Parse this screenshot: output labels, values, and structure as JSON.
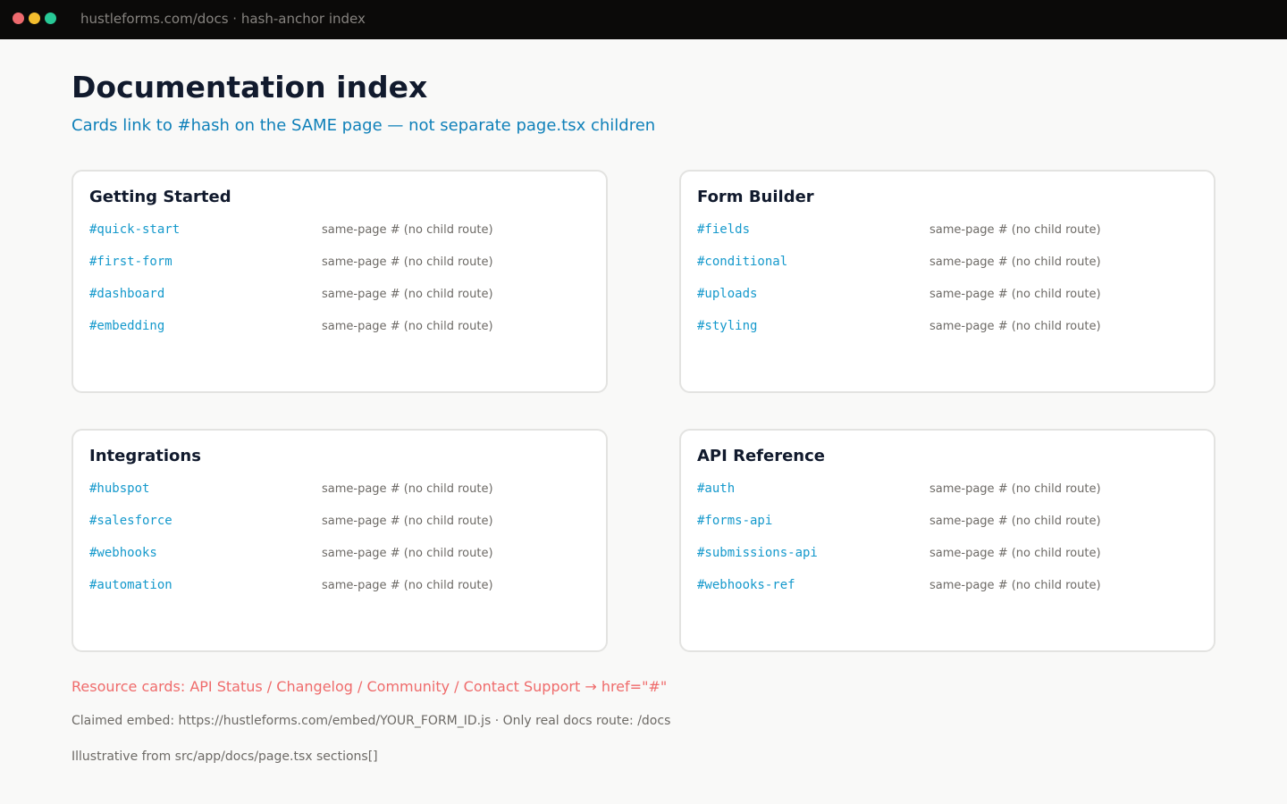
{
  "window": {
    "url": "hustleforms.com/docs · hash-anchor index",
    "controls": [
      "close",
      "minimize",
      "maximize"
    ]
  },
  "page": {
    "title": "Documentation index",
    "subtitle": "Cards link to #hash on the SAME page — not separate page.tsx children"
  },
  "sections": [
    {
      "title": "Getting Started",
      "items": [
        {
          "anchor": "#quick-start",
          "note": "same-page # (no child route)"
        },
        {
          "anchor": "#first-form",
          "note": "same-page # (no child route)"
        },
        {
          "anchor": "#dashboard",
          "note": "same-page # (no child route)"
        },
        {
          "anchor": "#embedding",
          "note": "same-page # (no child route)"
        }
      ]
    },
    {
      "title": "Form Builder",
      "items": [
        {
          "anchor": "#fields",
          "note": "same-page # (no child route)"
        },
        {
          "anchor": "#conditional",
          "note": "same-page # (no child route)"
        },
        {
          "anchor": "#uploads",
          "note": "same-page # (no child route)"
        },
        {
          "anchor": "#styling",
          "note": "same-page # (no child route)"
        }
      ]
    },
    {
      "title": "Integrations",
      "items": [
        {
          "anchor": "#hubspot",
          "note": "same-page # (no child route)"
        },
        {
          "anchor": "#salesforce",
          "note": "same-page # (no child route)"
        },
        {
          "anchor": "#webhooks",
          "note": "same-page # (no child route)"
        },
        {
          "anchor": "#automation",
          "note": "same-page # (no child route)"
        }
      ]
    },
    {
      "title": "API Reference",
      "items": [
        {
          "anchor": "#auth",
          "note": "same-page # (no child route)"
        },
        {
          "anchor": "#forms-api",
          "note": "same-page # (no child route)"
        },
        {
          "anchor": "#submissions-api",
          "note": "same-page # (no child route)"
        },
        {
          "anchor": "#webhooks-ref",
          "note": "same-page # (no child route)"
        }
      ]
    }
  ],
  "notes": {
    "resource_cards": "Resource cards: API Status / Changelog / Community / Contact Support → href=\"#\"",
    "embed": "Claimed embed: https://hustleforms.com/embed/YOUR_FORM_ID.js  ·  Only real docs route: /docs",
    "source": "Illustrative from src/app/docs/page.tsx sections[]"
  },
  "colors": {
    "titlebar": "#0b0a09",
    "heading": "#111a2d",
    "subtitle": "#0f80b9",
    "anchor": "#1599cc",
    "warning": "#ef6b6b",
    "muted": "#6d6a66"
  }
}
